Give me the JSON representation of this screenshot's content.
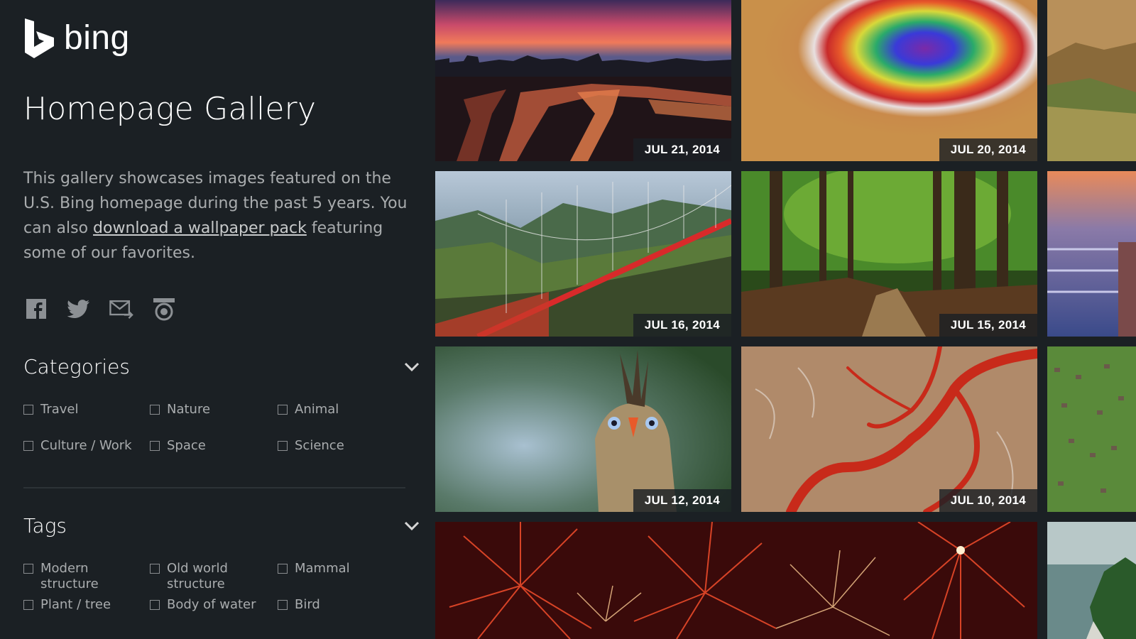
{
  "brand": {
    "logo_text": "bing"
  },
  "page": {
    "title": "Homepage Gallery",
    "description_before_link": "This gallery showcases images featured on the U.S. Bing homepage during the past 5 years. You can also ",
    "description_link": "download a wallpaper pack",
    "description_after_link": " featuring some of our favorites."
  },
  "share": {
    "icons": [
      "facebook-icon",
      "twitter-icon",
      "email-share-icon",
      "rss-icon"
    ]
  },
  "categories": {
    "title": "Categories",
    "items": [
      {
        "label": "Travel",
        "checked": false
      },
      {
        "label": "Nature",
        "checked": false
      },
      {
        "label": "Animal",
        "checked": false
      },
      {
        "label": "Culture / Work",
        "checked": false
      },
      {
        "label": "Space",
        "checked": false
      },
      {
        "label": "Science",
        "checked": false
      }
    ]
  },
  "tags": {
    "title": "Tags",
    "items": [
      {
        "label": "Modern structure",
        "checked": false
      },
      {
        "label": "Old world structure",
        "checked": false
      },
      {
        "label": "Mammal",
        "checked": false
      },
      {
        "label": "Plant / tree",
        "checked": false
      },
      {
        "label": "Body of water",
        "checked": false
      },
      {
        "label": "Bird",
        "checked": false
      }
    ]
  },
  "gallery": {
    "tiles": [
      {
        "date": "JUL 21, 2014",
        "subject": "city-skyline-lanterns"
      },
      {
        "date": "JUL 20, 2014",
        "subject": "crater-heatmap"
      },
      {
        "date": "",
        "subject": "canyon"
      },
      {
        "date": "JUL 16, 2014",
        "subject": "suspension-bridge"
      },
      {
        "date": "JUL 15, 2014",
        "subject": "forest-path"
      },
      {
        "date": "",
        "subject": "city-bridges"
      },
      {
        "date": "JUL 12, 2014",
        "subject": "bird"
      },
      {
        "date": "JUL 10, 2014",
        "subject": "red-river"
      },
      {
        "date": "",
        "subject": "herd-on-grass"
      },
      {
        "date": "",
        "subject": "fireworks"
      },
      {
        "date": "",
        "subject": "island-coast"
      }
    ]
  },
  "colors": {
    "background": "#1b2024",
    "text_primary": "#ffffff",
    "text_secondary": "#a9acae"
  }
}
